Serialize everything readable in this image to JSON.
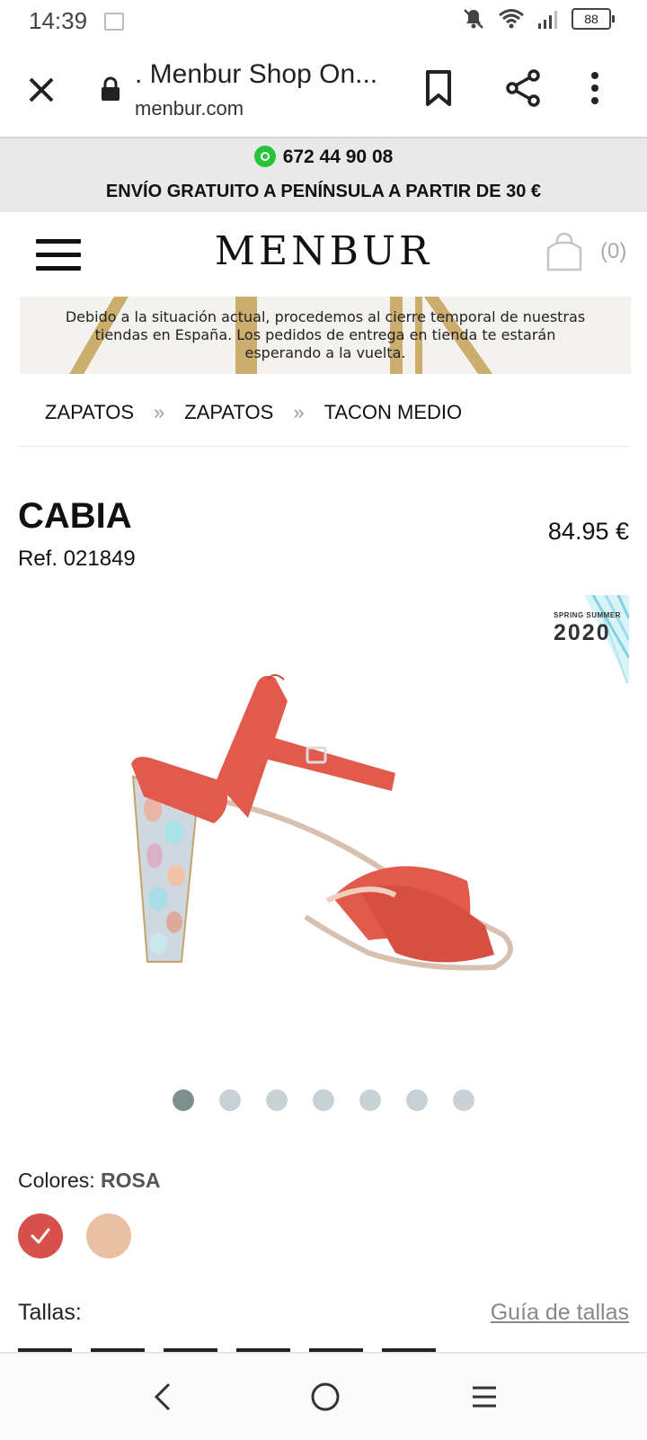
{
  "status_bar": {
    "time": "14:39",
    "battery": "88",
    "icons": [
      "image-notification-icon",
      "mute-icon",
      "wifi-icon",
      "signal-icon",
      "battery-icon"
    ]
  },
  "browser": {
    "title": ". Menbur Shop On...",
    "url": "menbur.com"
  },
  "promo": {
    "phone": "672 44 90 08",
    "shipping": "ENVÍO GRATUITO A PENÍNSULA A PARTIR DE 30 €"
  },
  "header": {
    "logo": "MENBUR",
    "cart_count": "(0)"
  },
  "notice": {
    "text": "Debido a la situación actual, procedemos al cierre temporal de nuestras tiendas en España. Los pedidos de entrega en tienda te estarán esperando a la vuelta."
  },
  "breadcrumb": {
    "items": [
      "ZAPATOS",
      "ZAPATOS",
      "TACON MEDIO"
    ],
    "separator": "»"
  },
  "product": {
    "name": "CABIA",
    "ref": "Ref. 021849",
    "price": "84.95 €",
    "season_small": "SPRING SUMMER",
    "season_year": "2020",
    "color_main": "#d8504b",
    "gallery_count": 7,
    "gallery_active": 1
  },
  "colors": {
    "label": "Colores:",
    "selected": "ROSA",
    "swatches": [
      "#d8504b",
      "#e9c0a1"
    ]
  },
  "sizes": {
    "label": "Tallas:",
    "guide_link": "Guía de tallas"
  }
}
